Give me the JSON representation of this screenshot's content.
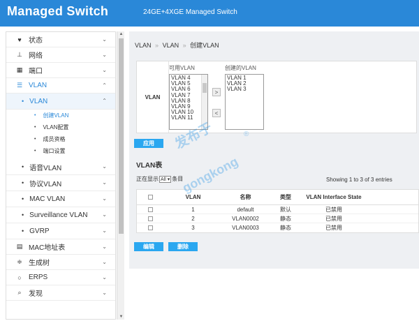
{
  "header": {
    "title": "Managed Switch",
    "model": "24GE+4XGE Managed Switch"
  },
  "sidebar": {
    "items": [
      {
        "label": "状态",
        "icon": "heart-pulse-icon"
      },
      {
        "label": "网络",
        "icon": "network-icon"
      },
      {
        "label": "端口",
        "icon": "grid-icon"
      },
      {
        "label": "VLAN",
        "icon": "server-icon"
      }
    ],
    "vlan_sub": {
      "label": "VLAN"
    },
    "vlan_pages": [
      {
        "label": "创建VLAN"
      },
      {
        "label": "VLAN配置"
      },
      {
        "label": "成员资格"
      },
      {
        "label": "端口设置"
      }
    ],
    "other_vlans": [
      {
        "label": "语音VLAN"
      },
      {
        "label": "协议VLAN"
      },
      {
        "label": "MAC VLAN"
      },
      {
        "label": "Surveillance VLAN"
      },
      {
        "label": "GVRP"
      }
    ],
    "bottom_items": [
      {
        "label": "MAC地址表",
        "icon": "database-icon"
      },
      {
        "label": "生成树",
        "icon": "sliders-icon"
      },
      {
        "label": "ERPS",
        "icon": "ring-icon"
      },
      {
        "label": "发现",
        "icon": "search-icon"
      }
    ]
  },
  "breadcrumb": {
    "b1": "VLAN",
    "b2": "VLAN",
    "b3": "创建VLAN",
    "sep": "»"
  },
  "create_panel": {
    "row_label": "VLAN",
    "available_title": "可用VLAN",
    "created_title": "创建的VLAN",
    "available": [
      "VLAN 4",
      "VLAN 5",
      "VLAN 6",
      "VLAN 7",
      "VLAN 8",
      "VLAN 9",
      "VLAN 10",
      "VLAN 11"
    ],
    "created": [
      "VLAN 1",
      "VLAN 2",
      "VLAN 3"
    ],
    "add_symbol": ">",
    "remove_symbol": "<",
    "apply_label": "应用"
  },
  "table": {
    "title": "VLAN表",
    "show_prefix": "正在显示",
    "show_value": "All",
    "show_suffix": "条目",
    "showing": "Showing 1 to 3 of 3 entries",
    "headers": {
      "vlan": "VLAN",
      "name": "名称",
      "type": "类型",
      "state": "VLAN Interface State"
    },
    "rows": [
      {
        "vlan": "1",
        "name": "default",
        "type": "默认",
        "state": "已禁用"
      },
      {
        "vlan": "2",
        "name": "VLAN0002",
        "type": "静态",
        "state": "已禁用"
      },
      {
        "vlan": "3",
        "name": "VLAN0003",
        "type": "静态",
        "state": "已禁用"
      }
    ],
    "edit_label": "编辑",
    "delete_label": "删除"
  },
  "watermark": {
    "line1": "发布于",
    "line2": "gongkong",
    "reg": "®"
  },
  "colors": {
    "brand": "#2a88d8",
    "button": "#2aa7f0"
  }
}
